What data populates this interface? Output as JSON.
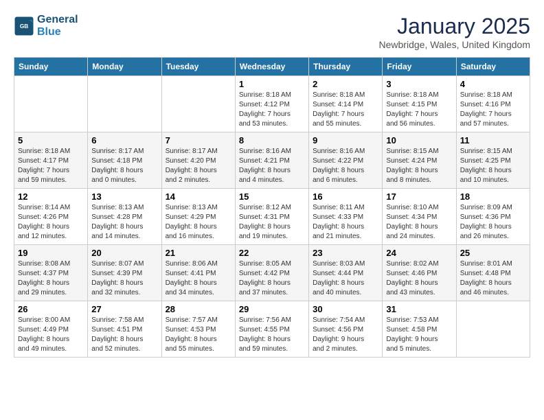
{
  "header": {
    "logo_line1": "General",
    "logo_line2": "Blue",
    "title": "January 2025",
    "location": "Newbridge, Wales, United Kingdom"
  },
  "weekdays": [
    "Sunday",
    "Monday",
    "Tuesday",
    "Wednesday",
    "Thursday",
    "Friday",
    "Saturday"
  ],
  "weeks": [
    [
      {
        "day": "",
        "info": ""
      },
      {
        "day": "",
        "info": ""
      },
      {
        "day": "",
        "info": ""
      },
      {
        "day": "1",
        "info": "Sunrise: 8:18 AM\nSunset: 4:12 PM\nDaylight: 7 hours\nand 53 minutes."
      },
      {
        "day": "2",
        "info": "Sunrise: 8:18 AM\nSunset: 4:14 PM\nDaylight: 7 hours\nand 55 minutes."
      },
      {
        "day": "3",
        "info": "Sunrise: 8:18 AM\nSunset: 4:15 PM\nDaylight: 7 hours\nand 56 minutes."
      },
      {
        "day": "4",
        "info": "Sunrise: 8:18 AM\nSunset: 4:16 PM\nDaylight: 7 hours\nand 57 minutes."
      }
    ],
    [
      {
        "day": "5",
        "info": "Sunrise: 8:18 AM\nSunset: 4:17 PM\nDaylight: 7 hours\nand 59 minutes."
      },
      {
        "day": "6",
        "info": "Sunrise: 8:17 AM\nSunset: 4:18 PM\nDaylight: 8 hours\nand 0 minutes."
      },
      {
        "day": "7",
        "info": "Sunrise: 8:17 AM\nSunset: 4:20 PM\nDaylight: 8 hours\nand 2 minutes."
      },
      {
        "day": "8",
        "info": "Sunrise: 8:16 AM\nSunset: 4:21 PM\nDaylight: 8 hours\nand 4 minutes."
      },
      {
        "day": "9",
        "info": "Sunrise: 8:16 AM\nSunset: 4:22 PM\nDaylight: 8 hours\nand 6 minutes."
      },
      {
        "day": "10",
        "info": "Sunrise: 8:15 AM\nSunset: 4:24 PM\nDaylight: 8 hours\nand 8 minutes."
      },
      {
        "day": "11",
        "info": "Sunrise: 8:15 AM\nSunset: 4:25 PM\nDaylight: 8 hours\nand 10 minutes."
      }
    ],
    [
      {
        "day": "12",
        "info": "Sunrise: 8:14 AM\nSunset: 4:26 PM\nDaylight: 8 hours\nand 12 minutes."
      },
      {
        "day": "13",
        "info": "Sunrise: 8:13 AM\nSunset: 4:28 PM\nDaylight: 8 hours\nand 14 minutes."
      },
      {
        "day": "14",
        "info": "Sunrise: 8:13 AM\nSunset: 4:29 PM\nDaylight: 8 hours\nand 16 minutes."
      },
      {
        "day": "15",
        "info": "Sunrise: 8:12 AM\nSunset: 4:31 PM\nDaylight: 8 hours\nand 19 minutes."
      },
      {
        "day": "16",
        "info": "Sunrise: 8:11 AM\nSunset: 4:33 PM\nDaylight: 8 hours\nand 21 minutes."
      },
      {
        "day": "17",
        "info": "Sunrise: 8:10 AM\nSunset: 4:34 PM\nDaylight: 8 hours\nand 24 minutes."
      },
      {
        "day": "18",
        "info": "Sunrise: 8:09 AM\nSunset: 4:36 PM\nDaylight: 8 hours\nand 26 minutes."
      }
    ],
    [
      {
        "day": "19",
        "info": "Sunrise: 8:08 AM\nSunset: 4:37 PM\nDaylight: 8 hours\nand 29 minutes."
      },
      {
        "day": "20",
        "info": "Sunrise: 8:07 AM\nSunset: 4:39 PM\nDaylight: 8 hours\nand 32 minutes."
      },
      {
        "day": "21",
        "info": "Sunrise: 8:06 AM\nSunset: 4:41 PM\nDaylight: 8 hours\nand 34 minutes."
      },
      {
        "day": "22",
        "info": "Sunrise: 8:05 AM\nSunset: 4:42 PM\nDaylight: 8 hours\nand 37 minutes."
      },
      {
        "day": "23",
        "info": "Sunrise: 8:03 AM\nSunset: 4:44 PM\nDaylight: 8 hours\nand 40 minutes."
      },
      {
        "day": "24",
        "info": "Sunrise: 8:02 AM\nSunset: 4:46 PM\nDaylight: 8 hours\nand 43 minutes."
      },
      {
        "day": "25",
        "info": "Sunrise: 8:01 AM\nSunset: 4:48 PM\nDaylight: 8 hours\nand 46 minutes."
      }
    ],
    [
      {
        "day": "26",
        "info": "Sunrise: 8:00 AM\nSunset: 4:49 PM\nDaylight: 8 hours\nand 49 minutes."
      },
      {
        "day": "27",
        "info": "Sunrise: 7:58 AM\nSunset: 4:51 PM\nDaylight: 8 hours\nand 52 minutes."
      },
      {
        "day": "28",
        "info": "Sunrise: 7:57 AM\nSunset: 4:53 PM\nDaylight: 8 hours\nand 55 minutes."
      },
      {
        "day": "29",
        "info": "Sunrise: 7:56 AM\nSunset: 4:55 PM\nDaylight: 8 hours\nand 59 minutes."
      },
      {
        "day": "30",
        "info": "Sunrise: 7:54 AM\nSunset: 4:56 PM\nDaylight: 9 hours\nand 2 minutes."
      },
      {
        "day": "31",
        "info": "Sunrise: 7:53 AM\nSunset: 4:58 PM\nDaylight: 9 hours\nand 5 minutes."
      },
      {
        "day": "",
        "info": ""
      }
    ]
  ]
}
